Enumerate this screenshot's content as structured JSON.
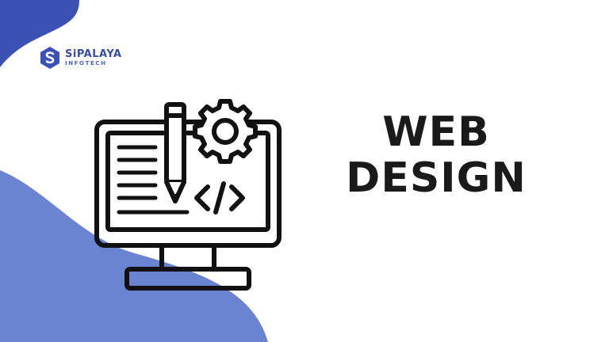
{
  "brand": {
    "name": "SiPALAYA",
    "tagline": "INFOTECH",
    "colors": {
      "primary": "#3b52b4",
      "light_blue": "#6a84d2",
      "text": "#1a1a1a"
    }
  },
  "headline": {
    "line1": "WEB",
    "line2": "DESIGN"
  },
  "icons": [
    "logo-s-icon",
    "monitor-icon",
    "pencil-icon",
    "gear-icon",
    "code-brackets-icon"
  ]
}
